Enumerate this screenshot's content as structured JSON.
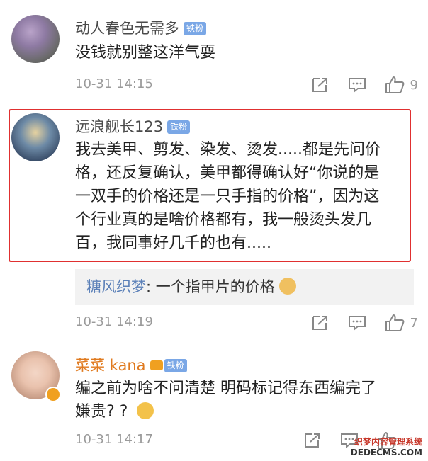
{
  "comments": [
    {
      "name": "动人春色无需多",
      "badge": "铁粉",
      "text": "没钱就别整这洋气耍",
      "time": "10-31 14:15",
      "likes": "9"
    },
    {
      "name": "远浪舰长123",
      "badge": "铁粉",
      "lines": [
        "我去美甲、剪发、染发、烫发.....都是先问价",
        "格，还反复确认，美甲都得确认好“你说的是",
        "一双手的价格还是一只手指的价格”，因为这",
        "个行业真的是啥价格都有，我一般烫头发几",
        "百，我同事好几千的也有....."
      ],
      "reply_name": "糖风织梦",
      "reply_text": ": 一个指甲片的价格",
      "time": "10-31 14:19",
      "likes": "7"
    },
    {
      "name": "菜菜 kana",
      "badge": "铁粉",
      "lines": [
        "编之前为啥不问清楚 明码标记得东西编完了",
        "嫌贵? ?"
      ],
      "time": "10-31 14:17"
    }
  ],
  "watermark": {
    "line1": "织梦内容管理系统",
    "line2": "DEDECMS.COM"
  },
  "colors": {
    "highlight": "#e03030",
    "badge": "#7aa7e6",
    "reply_name": "#5b80b8",
    "vip_name": "#e07a1f"
  }
}
